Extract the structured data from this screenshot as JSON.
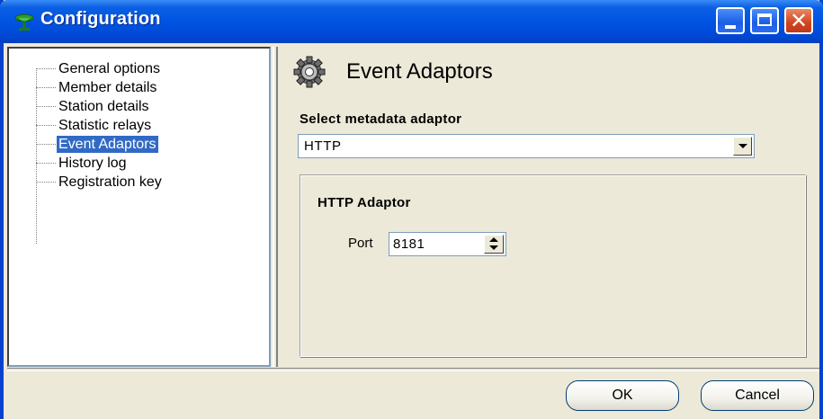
{
  "window": {
    "title": "Configuration",
    "icon": "satellite-dish-icon",
    "controls": [
      "minimize",
      "maximize",
      "close"
    ]
  },
  "tree": {
    "items": [
      {
        "label": "General options",
        "selected": false
      },
      {
        "label": "Member details",
        "selected": false
      },
      {
        "label": "Station details",
        "selected": false
      },
      {
        "label": "Statistic relays",
        "selected": false
      },
      {
        "label": "Event Adaptors",
        "selected": true
      },
      {
        "label": "History log",
        "selected": false
      },
      {
        "label": "Registration key",
        "selected": false
      }
    ]
  },
  "panel": {
    "icon": "gear-icon",
    "title": "Event Adaptors",
    "select_label": "Select metadata adaptor",
    "select_value": "HTTP",
    "group_title": "HTTP Adaptor",
    "port_label": "Port",
    "port_value": "8181"
  },
  "footer": {
    "ok_label": "OK",
    "cancel_label": "Cancel"
  },
  "colors": {
    "titlebar": "#0054e3",
    "selection": "#316ac5",
    "close_button": "#d1441f"
  }
}
